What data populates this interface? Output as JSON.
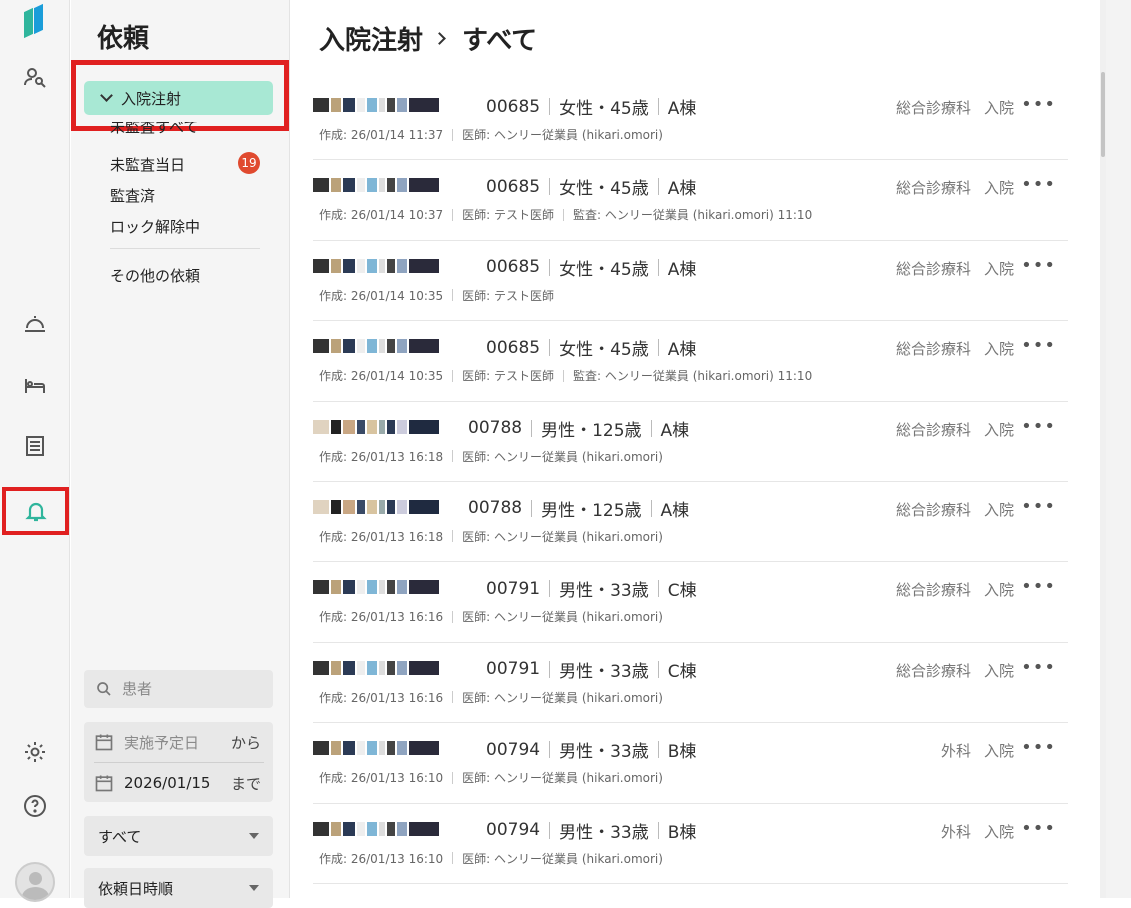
{
  "sidebar": {
    "title": "依頼",
    "selected": "入院注射",
    "items": [
      {
        "label": "未監査すべて"
      },
      {
        "label": "未監査当日",
        "badge": "19"
      },
      {
        "label": "監査済"
      },
      {
        "label": "ロック解除中"
      },
      {
        "label": "その他の依頼"
      }
    ],
    "search_placeholder": "患者",
    "date_from_placeholder": "実施予定日",
    "date_from_suffix": "から",
    "date_to_value": "2026/01/15",
    "date_to_suffix": "まで",
    "filter_value": "すべて",
    "sort_value": "依頼日時順"
  },
  "breadcrumb": {
    "parent": "入院注射",
    "current": "すべて"
  },
  "rows": [
    {
      "id": "00685",
      "sex_age": "女性・45歳",
      "ward": "A棟",
      "meta": [
        "作成: 26/01/14 11:37",
        "医師: ヘンリー従業員 (hikari.omori)"
      ],
      "dept": "総合診療科",
      "type": "入院"
    },
    {
      "id": "00685",
      "sex_age": "女性・45歳",
      "ward": "A棟",
      "meta": [
        "作成: 26/01/14 10:37",
        "医師: テスト医師",
        "監査: ヘンリー従業員 (hikari.omori) 11:10"
      ],
      "dept": "総合診療科",
      "type": "入院"
    },
    {
      "id": "00685",
      "sex_age": "女性・45歳",
      "ward": "A棟",
      "meta": [
        "作成: 26/01/14 10:35",
        "医師: テスト医師"
      ],
      "dept": "総合診療科",
      "type": "入院"
    },
    {
      "id": "00685",
      "sex_age": "女性・45歳",
      "ward": "A棟",
      "meta": [
        "作成: 26/01/14 10:35",
        "医師: テスト医師",
        "監査: ヘンリー従業員 (hikari.omori) 11:10"
      ],
      "dept": "総合診療科",
      "type": "入院"
    },
    {
      "id": "00788",
      "sex_age": "男性・125歳",
      "ward": "A棟",
      "meta": [
        "作成: 26/01/13 16:18",
        "医師: ヘンリー従業員 (hikari.omori)"
      ],
      "dept": "総合診療科",
      "type": "入院"
    },
    {
      "id": "00788",
      "sex_age": "男性・125歳",
      "ward": "A棟",
      "meta": [
        "作成: 26/01/13 16:18",
        "医師: ヘンリー従業員 (hikari.omori)"
      ],
      "dept": "総合診療科",
      "type": "入院"
    },
    {
      "id": "00791",
      "sex_age": "男性・33歳",
      "ward": "C棟",
      "meta": [
        "作成: 26/01/13 16:16",
        "医師: ヘンリー従業員 (hikari.omori)"
      ],
      "dept": "総合診療科",
      "type": "入院"
    },
    {
      "id": "00791",
      "sex_age": "男性・33歳",
      "ward": "C棟",
      "meta": [
        "作成: 26/01/13 16:16",
        "医師: ヘンリー従業員 (hikari.omori)"
      ],
      "dept": "総合診療科",
      "type": "入院"
    },
    {
      "id": "00794",
      "sex_age": "男性・33歳",
      "ward": "B棟",
      "meta": [
        "作成: 26/01/13 16:10",
        "医師: ヘンリー従業員 (hikari.omori)"
      ],
      "dept": "外科",
      "type": "入院"
    },
    {
      "id": "00794",
      "sex_age": "男性・33歳",
      "ward": "B棟",
      "meta": [
        "作成: 26/01/13 16:10",
        "医師: ヘンリー従業員 (hikari.omori)"
      ],
      "dept": "外科",
      "type": "入院"
    }
  ],
  "more_glyph": "•••",
  "colors": {
    "accent": "#a8e8d4",
    "badge": "#e04a2f",
    "highlight": "#e02020",
    "bell": "#2fb59c"
  }
}
